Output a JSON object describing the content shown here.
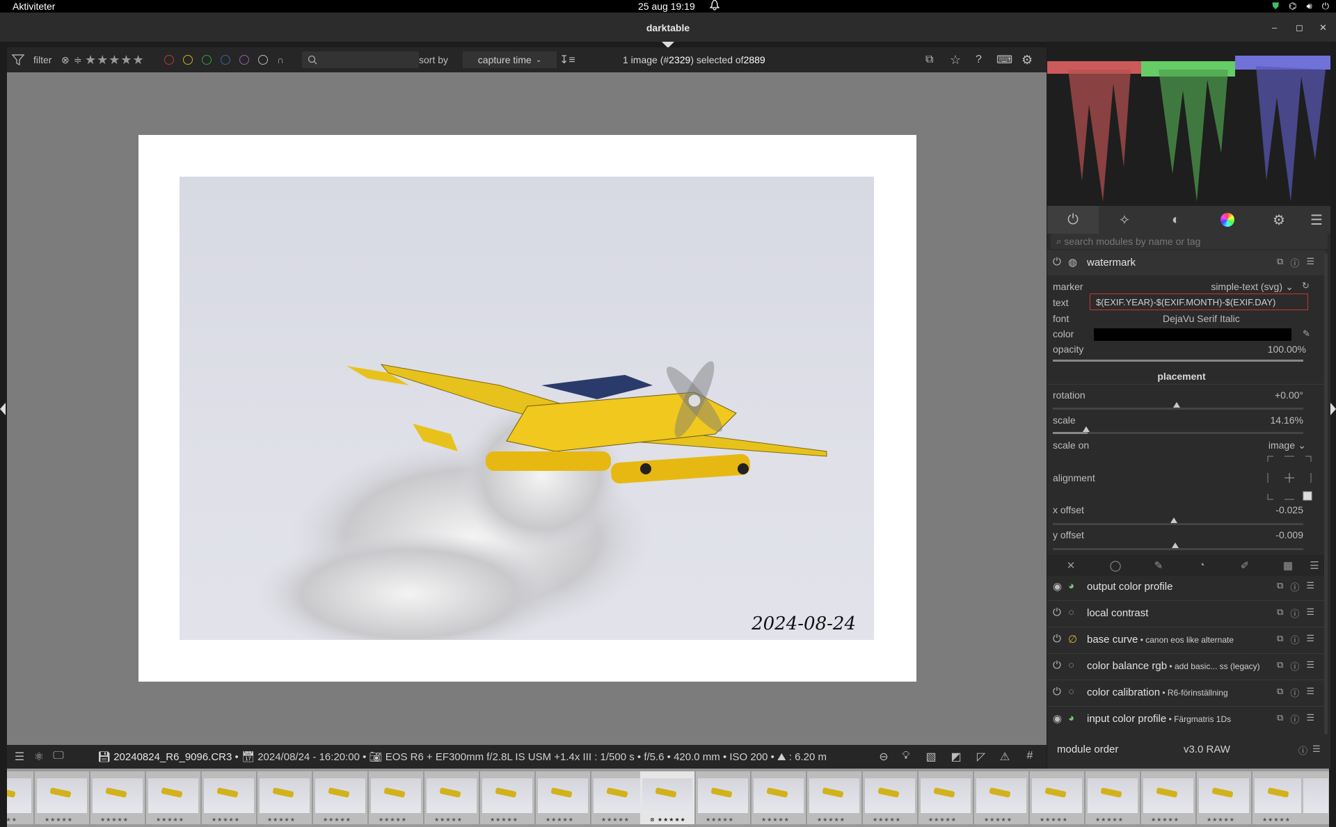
{
  "topbar": {
    "activities": "Aktiviteter",
    "clock": "25 aug  19:19"
  },
  "window": {
    "title": "darktable",
    "minimize": "–",
    "maximize": "◻",
    "close": "✕"
  },
  "toolbar": {
    "filter_label": "filter",
    "sort_label": "sort by",
    "sort_value": "capture time",
    "selection_prefix": "1 image (#",
    "image_number": "2329",
    "selection_mid": ") selected of ",
    "total": "2889",
    "stars": "★★★★★",
    "color_labels": [
      "#c0392b",
      "#c9b21d",
      "#2ea043",
      "#3465a4",
      "#9b59b6",
      "#bbbbbb"
    ]
  },
  "image": {
    "watermark_text": "2024-08-24"
  },
  "infobar": {
    "filename": "20240824_R6_9096.CR3",
    "date": "2024/08/24 - 16:20:00",
    "camera": "EOS R6 + EF300mm f/2.8L IS USM +1.4x III : 1/500 s • f/5.6 • 420.0 mm • ISO 200 •",
    "distance": ": 6.20 m"
  },
  "right_panel": {
    "search_placeholder": "search modules by name or tag",
    "watermark": {
      "name": "watermark",
      "marker_label": "marker",
      "marker_value": "simple-text (svg)",
      "text_label": "text",
      "text_value": "$(EXIF.YEAR)-$(EXIF.MONTH)-$(EXIF.DAY)",
      "font_label": "font",
      "font_value": "DejaVu Serif Italic",
      "color_label": "color",
      "opacity_label": "opacity",
      "opacity_value": "100.00%",
      "placement_label": "placement",
      "rotation_label": "rotation",
      "rotation_value": "+0.00°",
      "scale_label": "scale",
      "scale_value": "14.16%",
      "scale_on_label": "scale on",
      "scale_on_value": "image",
      "alignment_label": "alignment",
      "xoffset_label": "x offset",
      "xoffset_value": "-0.025",
      "yoffset_label": "y offset",
      "yoffset_value": "-0.009"
    },
    "modules": [
      {
        "name": "output color profile",
        "sub": ""
      },
      {
        "name": "local contrast",
        "sub": ""
      },
      {
        "name": "base curve",
        "sub": " • canon eos like alternate"
      },
      {
        "name": "color balance rgb",
        "sub": " • add basic... ss (legacy)"
      },
      {
        "name": "color calibration",
        "sub": " • R6-förinställning"
      },
      {
        "name": "input color profile",
        "sub": " • Färgmatris 1Ds"
      }
    ],
    "module_order_label": "module order",
    "module_order_value": "v3.0 RAW"
  }
}
